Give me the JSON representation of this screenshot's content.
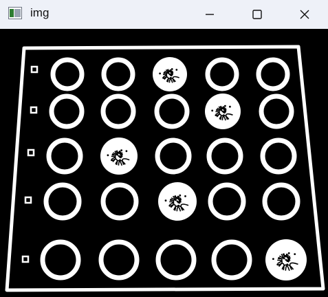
{
  "window": {
    "title": "img",
    "app_icon": "opencv-window-icon",
    "controls": {
      "minimize_icon": "minimize-icon",
      "maximize_icon": "maximize-icon",
      "close_icon": "close-icon"
    }
  },
  "image": {
    "description_kind": "binary-threshold",
    "colors": {
      "background": "#000000",
      "foreground": "#ffffff",
      "titlebar": "#eef1f8"
    },
    "grid": {
      "rows": 5,
      "cols": 5,
      "filled_wells": [
        {
          "row": 1,
          "col": 3
        },
        {
          "row": 2,
          "col": 4
        },
        {
          "row": 3,
          "col": 2
        },
        {
          "row": 4,
          "col": 3
        },
        {
          "row": 5,
          "col": 5
        }
      ]
    }
  }
}
